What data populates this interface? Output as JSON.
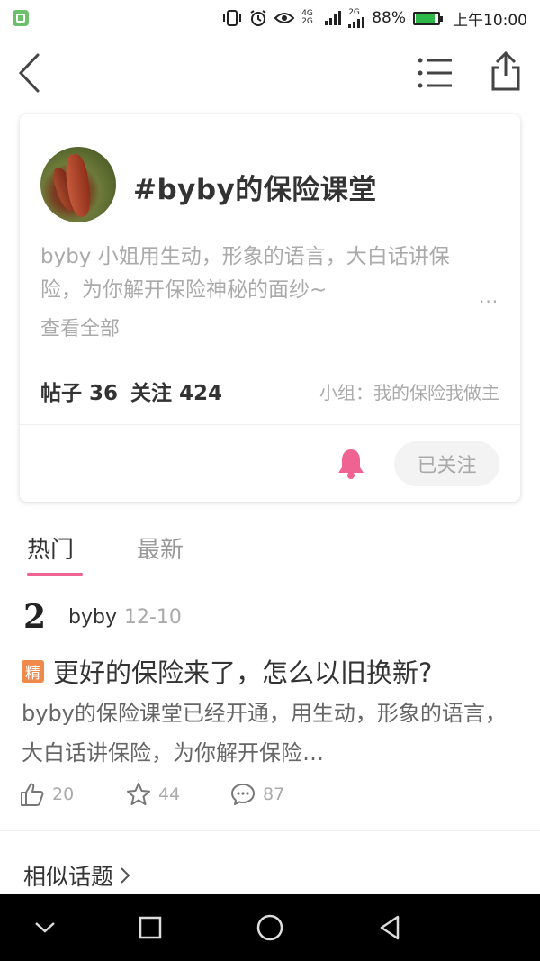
{
  "status_bar": {
    "network_label": "4G 2G",
    "signal2_label": "2G",
    "battery_percent": "88%",
    "battery_level": 0.88,
    "time": "上午10:00",
    "icons": [
      "app-icon",
      "vibrate-icon",
      "alarm-icon",
      "eye-icon",
      "signal-icon",
      "battery-icon"
    ]
  },
  "nav": {
    "icons": [
      "back-icon",
      "list-menu-icon",
      "share-icon"
    ]
  },
  "topic": {
    "title": "#byby的保险课堂",
    "description": "byby 小姐用生动，形象的语言，大白话讲保险，为你解开保险神秘的面纱~",
    "more_dots": "...",
    "view_all": "查看全部",
    "posts_label": "帖子 36",
    "followers_label": "关注 424",
    "group": "小组：我的保险我做主",
    "follow_button": "已关注",
    "bell_color": "#f06292"
  },
  "tabs": [
    {
      "label": "热门",
      "active": true
    },
    {
      "label": "最新",
      "active": false
    }
  ],
  "post": {
    "author_avatar_glyph": "2",
    "author": "byby",
    "date": "12-10",
    "badge": "精",
    "title": "更好的保险来了，怎么以旧换新?",
    "summary": "byby的保险课堂已经开通，用生动，形象的语言，大白话讲保险，为你解开保险…",
    "likes": "20",
    "favorites": "44",
    "comments": "87"
  },
  "similar_topics": {
    "label": "相似话题",
    "chevron": "›"
  },
  "system_nav": {
    "icons": [
      "collapse-icon",
      "recents-icon",
      "home-icon",
      "back-nav-icon"
    ]
  },
  "colors": {
    "accent": "#f06292",
    "badge": "#f08a4b",
    "muted_text": "#aaaaaa"
  }
}
